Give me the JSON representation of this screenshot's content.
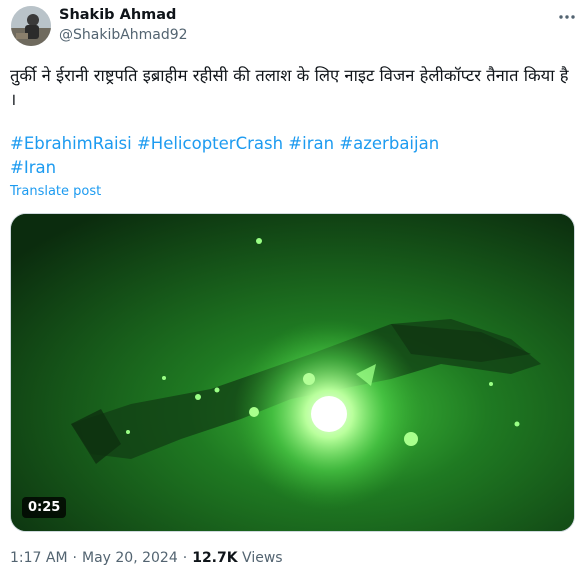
{
  "author": {
    "name": "Shakib Ahmad",
    "handle": "@ShakibAhmad92"
  },
  "tweet": {
    "text": "तुर्की ने ईरानी राष्ट्रपति इब्राहीम रहीसी की तलाश के लिए नाइट विजन हेलीकॉप्टर तैनात किया है ।",
    "hashtags": [
      "#EbrahimRaisi",
      "#HelicopterCrash",
      "#iran",
      "#azerbaijan",
      "#Iran"
    ],
    "translate_label": "Translate post"
  },
  "video": {
    "duration": "0:25"
  },
  "meta": {
    "time": "1:17 AM",
    "separator": "·",
    "date": "May 20, 2024",
    "views_count": "12.7K",
    "views_label": "Views"
  },
  "icons": {
    "more": "more-icon",
    "avatar": "avatar"
  },
  "colors": {
    "link": "#1d9bf0",
    "text": "#0f1419",
    "secondary": "#536471",
    "night_vision_green": "#1f7a22"
  }
}
